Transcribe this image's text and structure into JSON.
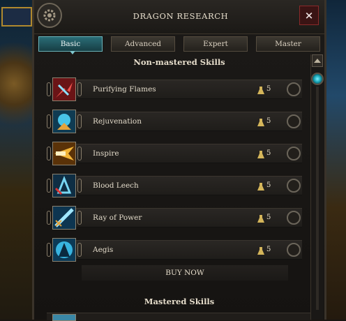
{
  "window": {
    "title": "DRAGON RESEARCH",
    "close_label": "×"
  },
  "tabs": [
    {
      "label": "Basic",
      "active": true
    },
    {
      "label": "Advanced",
      "active": false
    },
    {
      "label": "Expert",
      "active": false
    },
    {
      "label": "Master",
      "active": false
    }
  ],
  "sections": {
    "non_mastered": "Non-mastered Skills",
    "mastered": "Mastered Skills"
  },
  "skills": [
    {
      "name": "Purifying Flames",
      "cost": "5",
      "icon": "purifying-flames-icon",
      "color": "#c9343a"
    },
    {
      "name": "Rejuvenation",
      "cost": "5",
      "icon": "rejuvenation-icon",
      "color": "#2aa6c9"
    },
    {
      "name": "Inspire",
      "cost": "5",
      "icon": "inspire-icon",
      "color": "#d48a22"
    },
    {
      "name": "Blood Leech",
      "cost": "5",
      "icon": "blood-leech-icon",
      "color": "#3f8fb4"
    },
    {
      "name": "Ray of Power",
      "cost": "5",
      "icon": "ray-of-power-icon",
      "color": "#3a9ccc"
    },
    {
      "name": "Aegis",
      "cost": "5",
      "icon": "aegis-icon",
      "color": "#29a9d6"
    }
  ],
  "buy_button": "BUY NOW",
  "colors": {
    "accent_teal": "#2a6d77",
    "gold": "#d4b55a"
  }
}
